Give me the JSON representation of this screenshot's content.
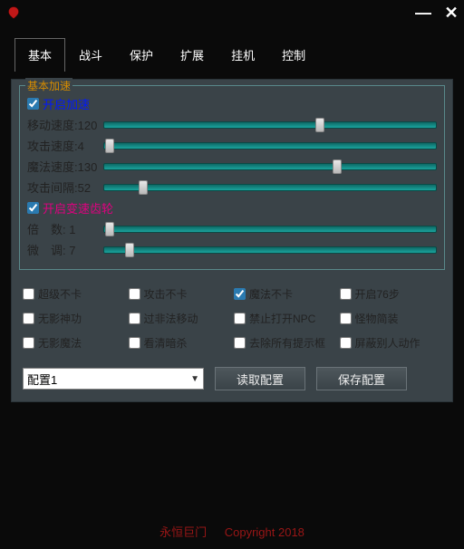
{
  "titlebar": {
    "minimize": "—",
    "close": "✕"
  },
  "tabs": [
    {
      "label": "基本",
      "active": true
    },
    {
      "label": "战斗",
      "active": false
    },
    {
      "label": "保护",
      "active": false
    },
    {
      "label": "扩展",
      "active": false
    },
    {
      "label": "挂机",
      "active": false
    },
    {
      "label": "控制",
      "active": false
    }
  ],
  "speed_group": {
    "legend": "基本加速",
    "enable_speed": {
      "label": "开启加速",
      "checked": true
    },
    "enable_gear": {
      "label": "开启变速齿轮",
      "checked": true
    },
    "sliders": [
      {
        "key": "move",
        "label": "移动速度:120",
        "pos": 65
      },
      {
        "key": "attack",
        "label": "攻击速度:4",
        "pos": 2
      },
      {
        "key": "magic",
        "label": "魔法速度:130",
        "pos": 70
      },
      {
        "key": "atkint",
        "label": "攻击间隔:52",
        "pos": 12
      },
      {
        "key": "mult",
        "label": "倍　数: 1",
        "pos": 2
      },
      {
        "key": "fine",
        "label": "微　调: 7",
        "pos": 8
      }
    ]
  },
  "options": [
    {
      "label": "超级不卡",
      "checked": false
    },
    {
      "label": "攻击不卡",
      "checked": false
    },
    {
      "label": "魔法不卡",
      "checked": true
    },
    {
      "label": "开启76步",
      "checked": false
    },
    {
      "label": "无影神功",
      "checked": false
    },
    {
      "label": "过非法移动",
      "checked": false
    },
    {
      "label": "禁止打开NPC",
      "checked": false
    },
    {
      "label": "怪物简装",
      "checked": false
    },
    {
      "label": "无影魔法",
      "checked": false
    },
    {
      "label": "看清暗杀",
      "checked": false
    },
    {
      "label": "去除所有提示框",
      "checked": false
    },
    {
      "label": "屏蔽别人动作",
      "checked": false
    }
  ],
  "config": {
    "selected": "配置1",
    "load": "读取配置",
    "save": "保存配置"
  },
  "footer": {
    "brand": "永恒巨门",
    "copyright": "Copyright 2018"
  }
}
